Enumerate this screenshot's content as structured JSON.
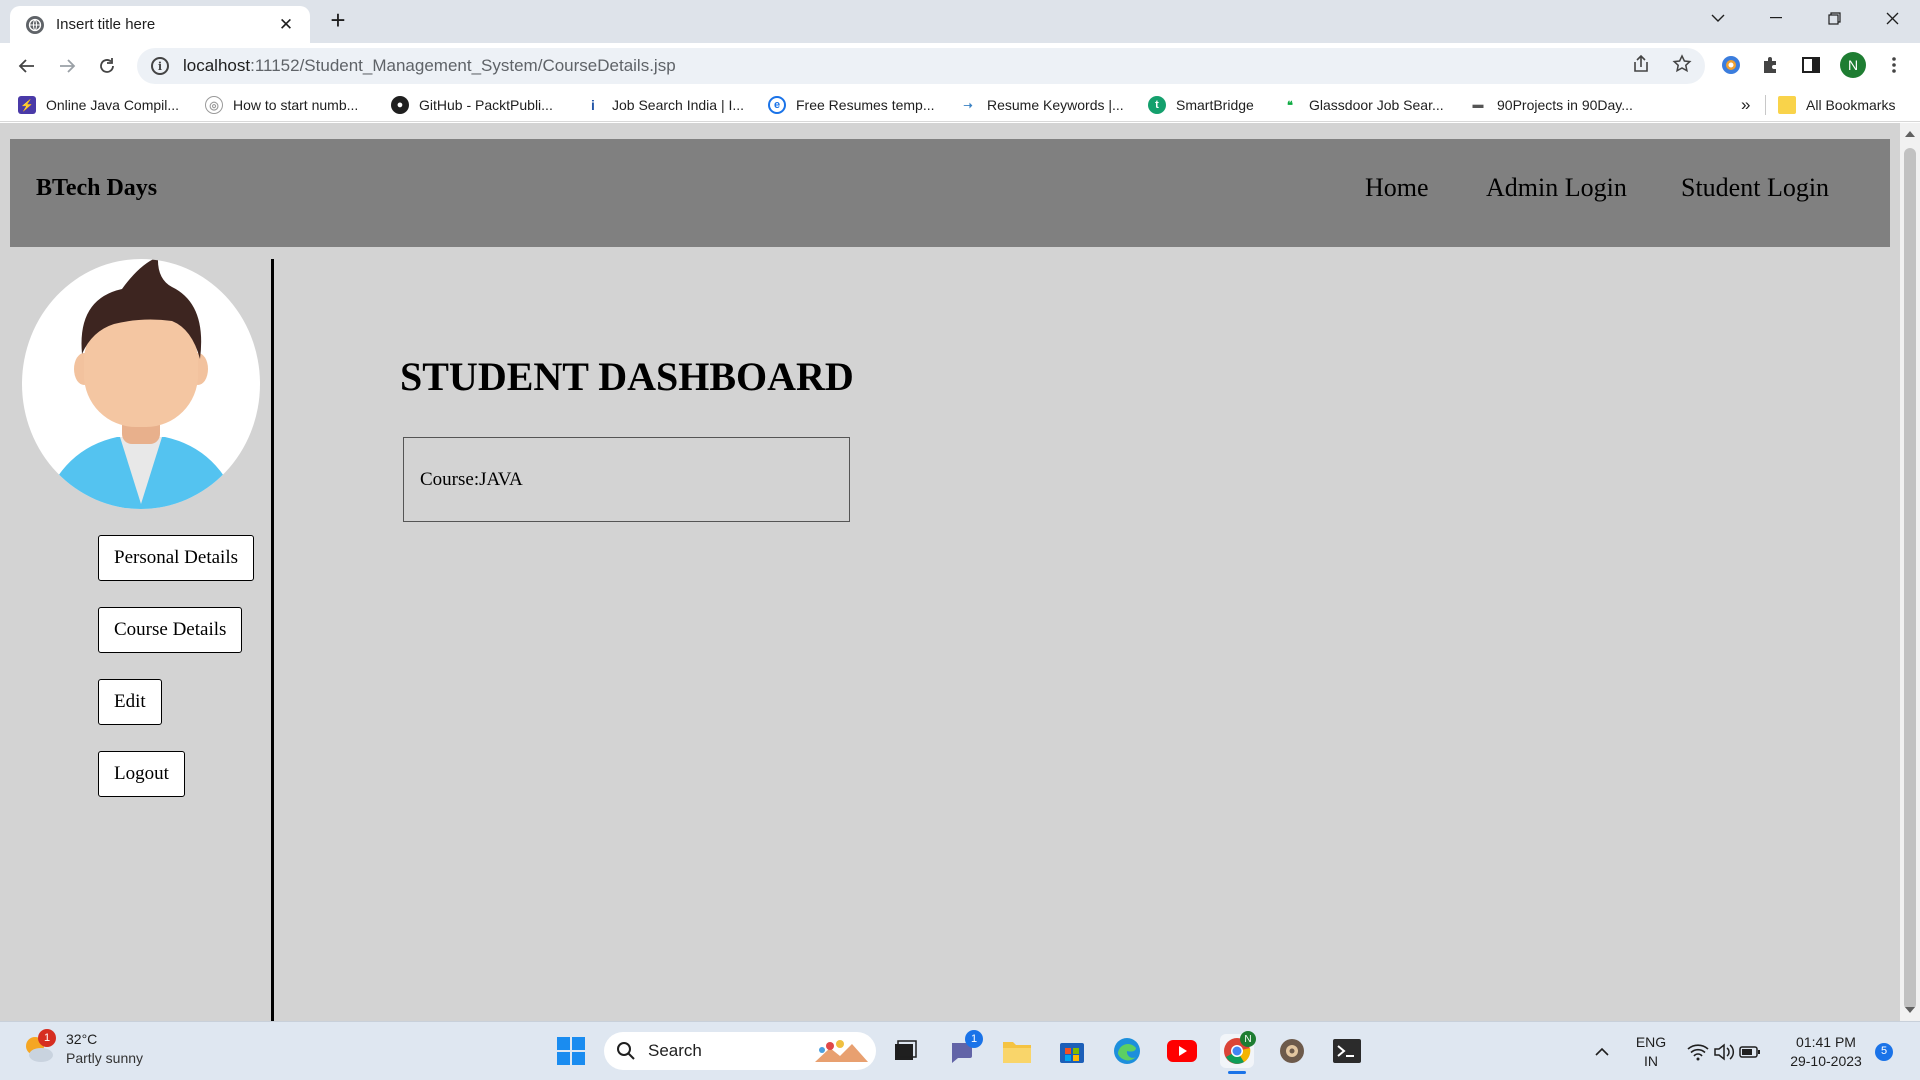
{
  "browser": {
    "tab_title": "Insert title here",
    "url_host": "localhost",
    "url_rest": ":11152/Student_Management_System/CourseDetails.jsp",
    "profile_initial": "N",
    "bookmarks": [
      {
        "label": "Online Java Compil...",
        "icon": "java-compiler-icon",
        "color": "#4a3aa8"
      },
      {
        "label": "How to start numb...",
        "icon": "numb-icon",
        "color": "#9a9a9a"
      },
      {
        "label": "GitHub - PacktPubli...",
        "icon": "github-icon",
        "color": "#1f1f1f"
      },
      {
        "label": "Job Search India | I...",
        "icon": "indeed-icon",
        "color": "#2557a7"
      },
      {
        "label": "Free Resumes temp...",
        "icon": "resume-icon",
        "color": "#1a73e8"
      },
      {
        "label": "Resume Keywords |...",
        "icon": "keywords-icon",
        "color": "#3b82c4"
      },
      {
        "label": "SmartBridge",
        "icon": "smartbridge-icon",
        "color": "#14a06d"
      },
      {
        "label": "Glassdoor Job Sear...",
        "icon": "glassdoor-icon",
        "color": "#0caa41"
      },
      {
        "label": "90Projects in 90Day...",
        "icon": "projects-icon",
        "color": "#555555"
      }
    ],
    "bookmarks_overflow": "»",
    "all_bookmarks": "All Bookmarks"
  },
  "page": {
    "brand": "BTech Days",
    "nav": {
      "home": "Home",
      "admin_login": "Admin Login",
      "student_login": "Student Login"
    },
    "sidebar": {
      "personal_details": "Personal Details",
      "course_details": "Course Details",
      "edit": "Edit",
      "logout": "Logout"
    },
    "dashboard_title": "STUDENT DASHBOARD",
    "course_label": "Course:",
    "course_value": "JAVA"
  },
  "taskbar": {
    "weather_temp": "32°C",
    "weather_cond": "Partly sunny",
    "weather_badge": "1",
    "search_placeholder": "Search",
    "chat_badge": "1",
    "lang_top": "ENG",
    "lang_bottom": "IN",
    "time": "01:41 PM",
    "date": "29-10-2023",
    "notifications": "5"
  }
}
